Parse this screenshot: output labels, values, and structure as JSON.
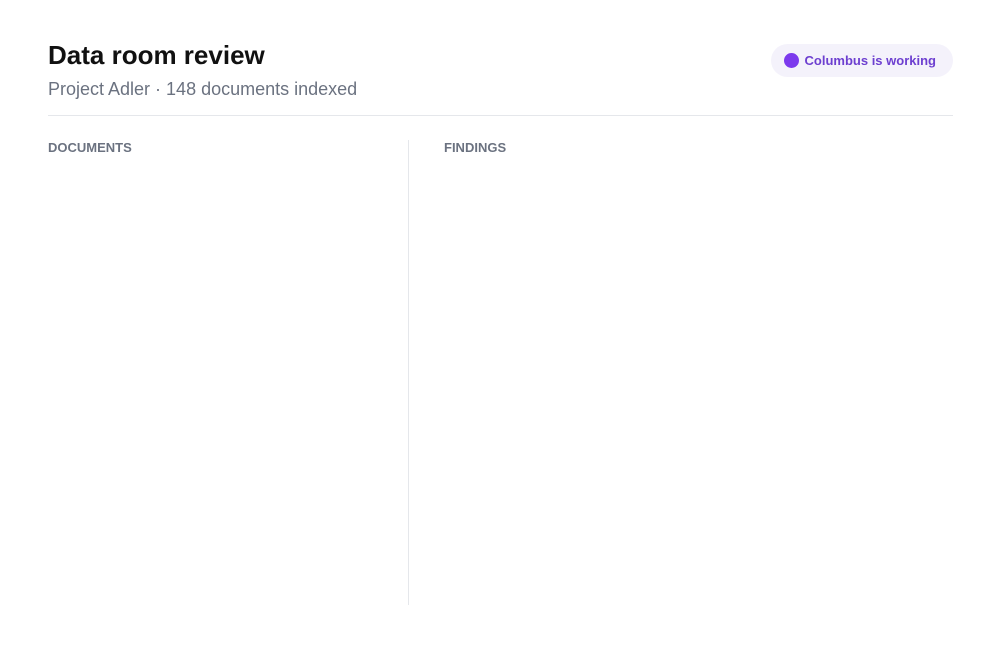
{
  "header": {
    "title": "Data room review",
    "subtitle": "Project Adler · 148 documents indexed"
  },
  "status": {
    "text": "Columbus is working",
    "dot_color": "#7c3aed",
    "pill_color": "#f4f2fb",
    "text_color": "#6d3fd0"
  },
  "documents": {
    "label": "DOCUMENTS",
    "items": []
  },
  "findings": {
    "label": "FINDINGS",
    "items": []
  }
}
